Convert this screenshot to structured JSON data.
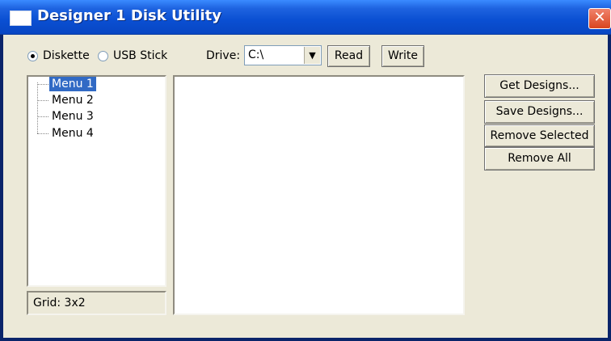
{
  "window": {
    "title": "Designer 1 Disk Utility"
  },
  "source": {
    "options": [
      "Diskette",
      "USB Stick"
    ],
    "selected": "Diskette"
  },
  "drive": {
    "label": "Drive:",
    "value": "C:\\"
  },
  "buttons": {
    "read": "Read",
    "write": "Write",
    "get_designs": "Get Designs...",
    "save_designs": "Save Designs...",
    "remove_selected": "Remove Selected",
    "remove_all": "Remove All"
  },
  "tree": {
    "items": [
      "Menu 1",
      "Menu 2",
      "Menu 3",
      "Menu 4"
    ],
    "selected": "Menu 1"
  },
  "status": {
    "grid": "Grid: 3x2"
  }
}
